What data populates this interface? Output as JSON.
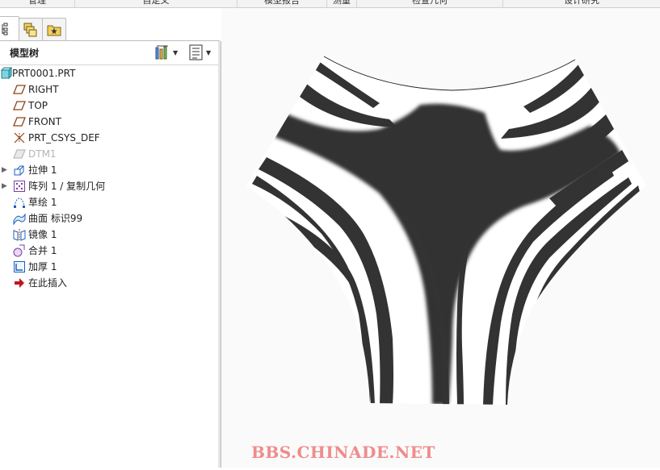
{
  "menu": {
    "items": [
      "管理",
      "自定义",
      "模型报告",
      "测量",
      "检查几何",
      "设计研究"
    ]
  },
  "navigator": {
    "tabs": [
      {
        "icon": "model-tree-icon"
      },
      {
        "icon": "layer-tree-icon"
      },
      {
        "icon": "favorites-folder-icon"
      }
    ]
  },
  "model_tree": {
    "title": "模型树",
    "settings_icon": "tree-settings-icon",
    "show_icon": "tree-show-icon",
    "items": [
      {
        "label": "PRT0001.PRT",
        "icon": "part-icon",
        "root": true
      },
      {
        "label": "RIGHT",
        "icon": "datum-plane-icon"
      },
      {
        "label": "TOP",
        "icon": "datum-plane-icon"
      },
      {
        "label": "FRONT",
        "icon": "datum-plane-icon"
      },
      {
        "label": "PRT_CSYS_DEF",
        "icon": "csys-icon"
      },
      {
        "label": "DTM1",
        "icon": "datum-plane-icon",
        "disabled": true
      },
      {
        "label": "拉伸 1",
        "icon": "extrude-icon",
        "expandable": true
      },
      {
        "label": "阵列 1 / 复制几何",
        "icon": "pattern-icon",
        "expandable": true
      },
      {
        "label": "草绘 1",
        "icon": "sketch-icon"
      },
      {
        "label": "曲面 标识99",
        "icon": "surface-icon"
      },
      {
        "label": "镜像 1",
        "icon": "mirror-icon"
      },
      {
        "label": "合并 1",
        "icon": "merge-icon"
      },
      {
        "label": "加厚 1",
        "icon": "thicken-icon"
      },
      {
        "label": "在此插入",
        "icon": "insert-here-icon"
      }
    ]
  },
  "watermark": "BBS.CHINADE.NET",
  "colors": {
    "stripe_dark": "#333333",
    "stripe_light": "#ffffff",
    "watermark": "#f08b8b",
    "plane_icon": "#8b4513"
  }
}
